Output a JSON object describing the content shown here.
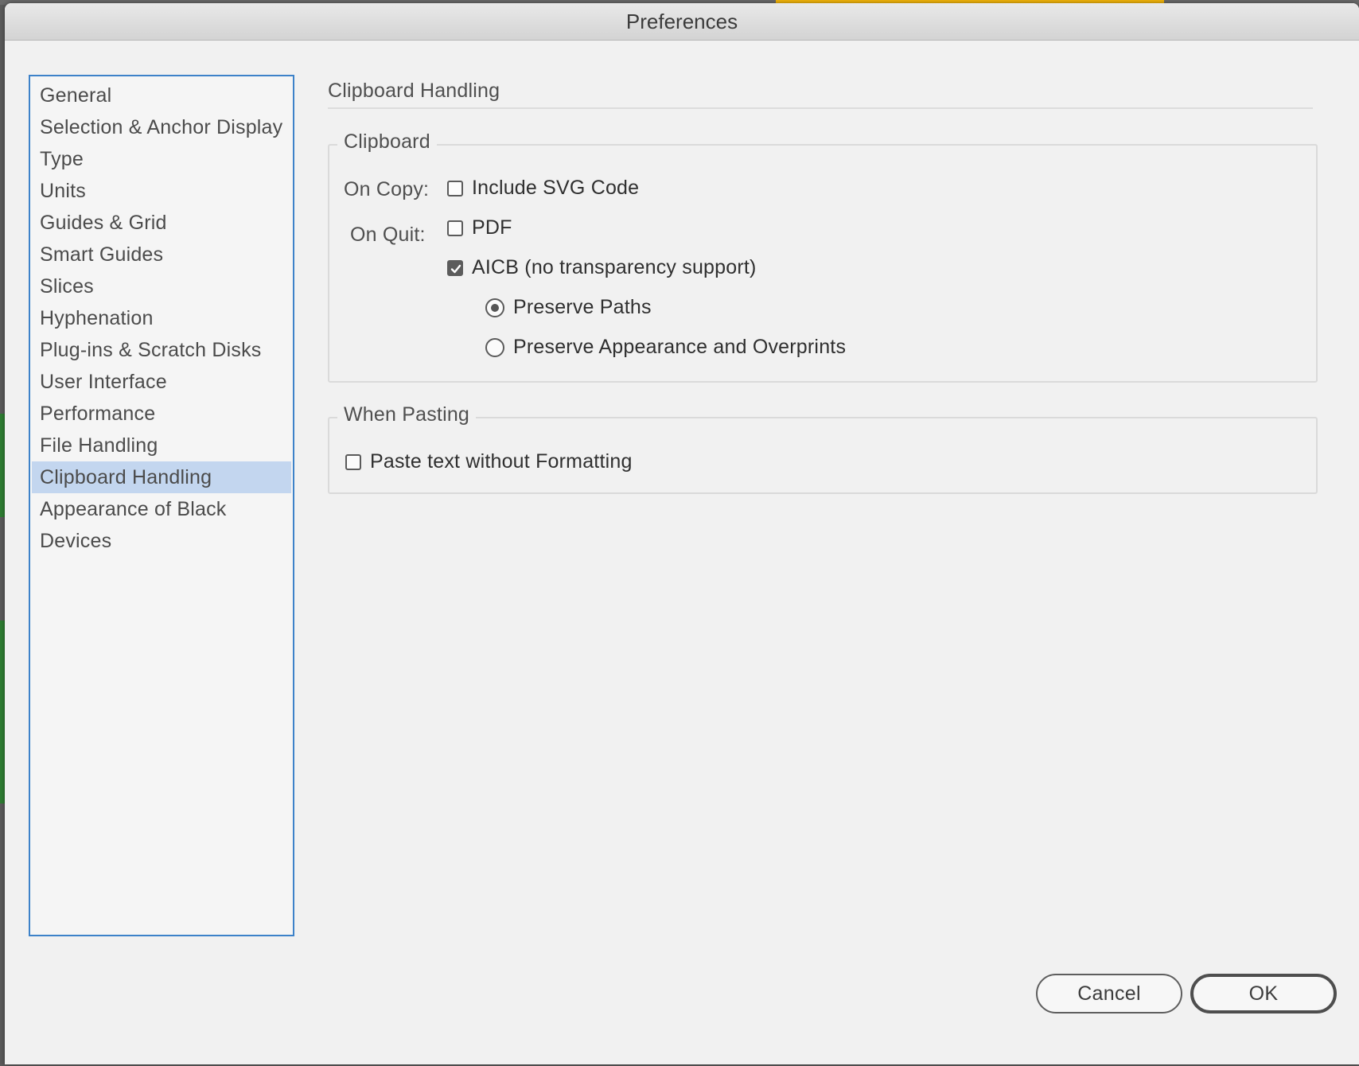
{
  "window": {
    "title": "Preferences"
  },
  "sidebar": {
    "items": [
      {
        "label": "General",
        "selected": false
      },
      {
        "label": "Selection & Anchor Display",
        "selected": false
      },
      {
        "label": "Type",
        "selected": false
      },
      {
        "label": "Units",
        "selected": false
      },
      {
        "label": "Guides & Grid",
        "selected": false
      },
      {
        "label": "Smart Guides",
        "selected": false
      },
      {
        "label": "Slices",
        "selected": false
      },
      {
        "label": "Hyphenation",
        "selected": false
      },
      {
        "label": "Plug-ins & Scratch Disks",
        "selected": false
      },
      {
        "label": "User Interface",
        "selected": false
      },
      {
        "label": "Performance",
        "selected": false
      },
      {
        "label": "File Handling",
        "selected": false
      },
      {
        "label": "Clipboard Handling",
        "selected": true
      },
      {
        "label": "Appearance of Black",
        "selected": false
      },
      {
        "label": "Devices",
        "selected": false
      }
    ]
  },
  "main": {
    "section_title": "Clipboard Handling",
    "clipboard_group": {
      "legend": "Clipboard",
      "on_copy_label": "On Copy:",
      "on_quit_label": "On Quit:",
      "include_svg": {
        "label": "Include SVG Code",
        "checked": false
      },
      "pdf": {
        "label": "PDF",
        "checked": false
      },
      "aicb": {
        "label": "AICB (no transparency support)",
        "checked": true
      },
      "preserve_paths": {
        "label": "Preserve Paths",
        "selected": true
      },
      "preserve_appearance": {
        "label": "Preserve Appearance and Overprints",
        "selected": false
      }
    },
    "pasting_group": {
      "legend": "When Pasting",
      "paste_text": {
        "label": "Paste text without Formatting",
        "checked": false
      }
    }
  },
  "buttons": {
    "cancel": "Cancel",
    "ok": "OK"
  },
  "colors": {
    "selection_highlight": "#c3d6ef",
    "sidebar_border": "#3d82c9",
    "dialog_background": "#f1f1f1"
  }
}
